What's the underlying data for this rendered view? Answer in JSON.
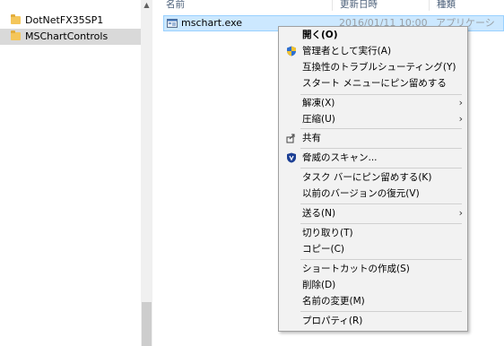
{
  "nav": {
    "items": [
      {
        "label": "DotNetFX35SP1",
        "selected": false
      },
      {
        "label": "MSChartControls",
        "selected": true
      }
    ]
  },
  "file_list": {
    "columns": {
      "name": "名前",
      "date": "更新日時",
      "type": "種類"
    },
    "rows": [
      {
        "name": "mschart.exe",
        "date": "2016/01/11 10:00",
        "type": "アプリケーション"
      }
    ]
  },
  "context_menu": {
    "items": [
      {
        "label": "開く(O)",
        "bold": true
      },
      {
        "label": "管理者として実行(A)",
        "icon": "uac-shield-icon"
      },
      {
        "label": "互換性のトラブルシューティング(Y)"
      },
      {
        "label": "スタート メニューにピン留めする"
      },
      {
        "label": "解凍(X)",
        "submenu": true
      },
      {
        "label": "圧縮(U)",
        "submenu": true
      },
      {
        "label": "共有",
        "icon": "share-icon"
      },
      {
        "label": "脅威のスキャン...",
        "icon": "defender-shield-icon"
      },
      {
        "label": "タスク バーにピン留めする(K)"
      },
      {
        "label": "以前のバージョンの復元(V)"
      },
      {
        "label": "送る(N)",
        "submenu": true
      },
      {
        "label": "切り取り(T)"
      },
      {
        "label": "コピー(C)"
      },
      {
        "label": "ショートカットの作成(S)"
      },
      {
        "label": "削除(D)"
      },
      {
        "label": "名前の変更(M)"
      },
      {
        "label": "プロパティ(R)"
      }
    ],
    "submenu_arrow": "›"
  },
  "colors": {
    "selection_bg": "#cce8ff",
    "nav_selected_bg": "#d9d9d9",
    "menu_bg": "#f2f2f2",
    "column_header_text": "#4c607a"
  }
}
